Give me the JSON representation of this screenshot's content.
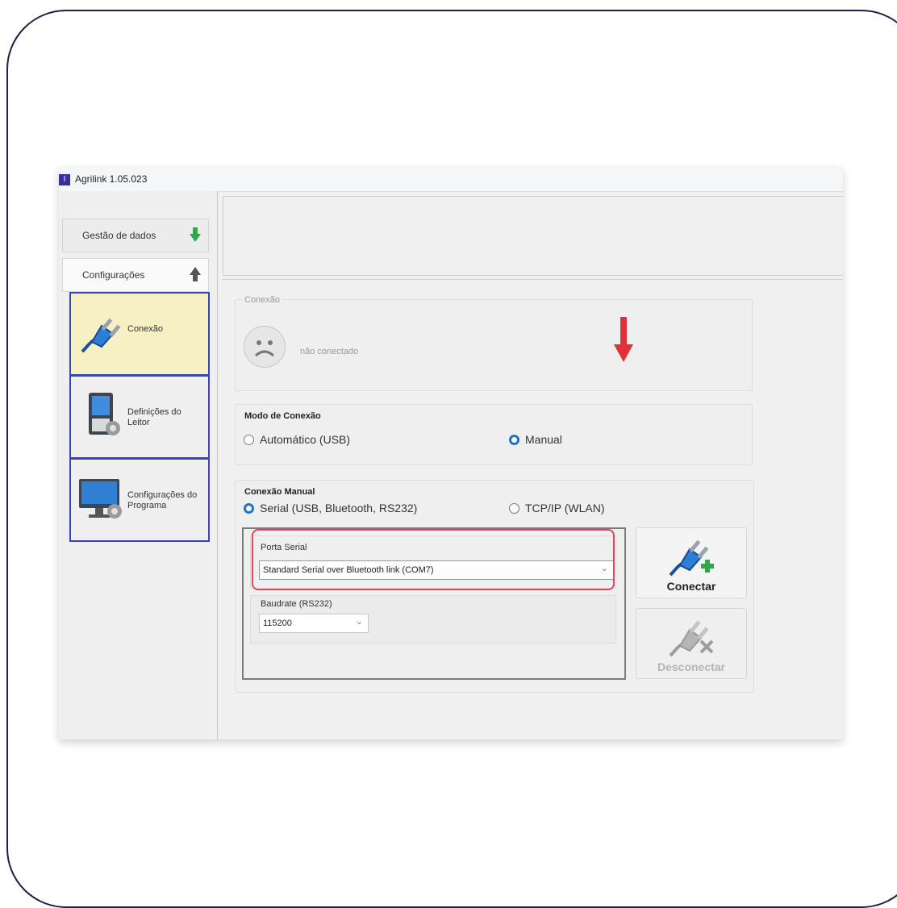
{
  "window": {
    "title": "Agrilink 1.05.023",
    "icon_text": "I"
  },
  "sidebar": {
    "tabs": [
      {
        "label": "Gestão de dados",
        "arrow_icon": "green-down-arrow-icon",
        "arrow_color": "#2ea84a"
      },
      {
        "label": "Configurações",
        "arrow_icon": "gray-up-arrow-icon",
        "arrow_color": "#555555"
      }
    ],
    "items": [
      {
        "label": "Conexão",
        "icon": "plug-icon",
        "active": true
      },
      {
        "label": "Definições do Leitor",
        "icon": "reader-device-icon",
        "active": false
      },
      {
        "label": "Configurações do Programa",
        "icon": "monitor-gear-icon",
        "active": false
      }
    ]
  },
  "connection_status": {
    "legend": "Conexão",
    "icon": "sad-face-icon",
    "status_text": "não conectado"
  },
  "connection_mode": {
    "legend": "Modo de Conexão",
    "options": [
      {
        "label": "Automático (USB)",
        "selected": false
      },
      {
        "label": "Manual",
        "selected": true
      }
    ]
  },
  "manual_connection": {
    "legend": "Conexão Manual",
    "options": [
      {
        "label": "Serial (USB, Bluetooth, RS232)",
        "selected": true
      },
      {
        "label": "TCP/IP (WLAN)",
        "selected": false
      }
    ],
    "serial_port": {
      "label": "Porta Serial",
      "value": "Standard Serial over Bluetooth link (COM7)"
    },
    "baudrate": {
      "label": "Baudrate (RS232)",
      "value": "115200"
    }
  },
  "buttons": {
    "connect": {
      "label": "Conectar",
      "enabled": true,
      "icon": "plug-plus-icon"
    },
    "disconnect": {
      "label": "Desconectar",
      "enabled": false,
      "icon": "plug-x-icon"
    }
  },
  "annotations": {
    "highlight_color": "#e0475e",
    "arrow_color": "#e0303a"
  }
}
